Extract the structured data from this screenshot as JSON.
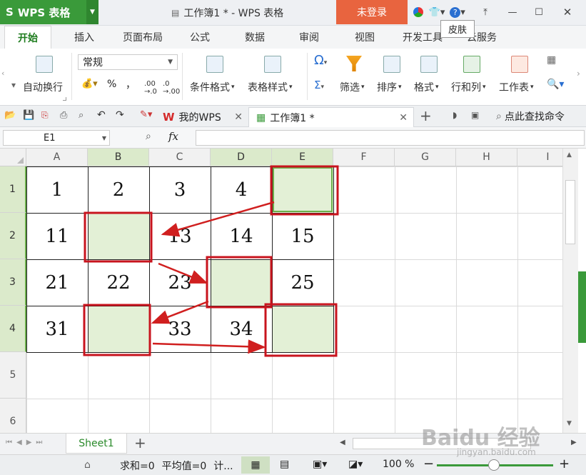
{
  "app": {
    "brand": "WPS 表格",
    "doc_title": "工作簿1 * - WPS 表格",
    "login_label": "未登录",
    "tooltip": "皮肤"
  },
  "ribbon_tabs": [
    "开始",
    "插入",
    "页面布局",
    "公式",
    "数据",
    "审阅",
    "视图",
    "开发工具",
    "云服务"
  ],
  "ribbon": {
    "wrap_label": "自动换行",
    "format_value": "常规",
    "percent": "%",
    "comma": "，",
    "cond_format": "条件格式",
    "table_style": "表格样式",
    "symbol": "Ω",
    "sum": "Σ",
    "filter": "筛选",
    "sort": "排序",
    "format": "格式",
    "row_col": "行和列",
    "worksheet": "工作表"
  },
  "doc_tabs": [
    {
      "label": "我的WPS"
    },
    {
      "label": "工作簿1 *"
    }
  ],
  "search_cmd": "点此查找命令",
  "name_box": "E1",
  "fx": "fx",
  "columns": [
    "A",
    "B",
    "C",
    "D",
    "E",
    "F",
    "G",
    "H",
    "I"
  ],
  "rows": [
    "1",
    "2",
    "3",
    "4",
    "5",
    "6"
  ],
  "cells": [
    [
      "1",
      "2",
      "3",
      "4",
      ""
    ],
    [
      "11",
      "",
      "13",
      "14",
      "15"
    ],
    [
      "21",
      "22",
      "23",
      "",
      "25"
    ],
    [
      "31",
      "",
      "33",
      "34",
      ""
    ]
  ],
  "sheet_tab": "Sheet1",
  "status": {
    "sum": "求和=0",
    "avg": "平均值=0",
    "more": "计...",
    "zoom": "100 %"
  },
  "watermark": {
    "main": "Baidu 经验",
    "sub": "jingyan.baidu.com"
  },
  "colors": {
    "brand_green": "#3a9a3a",
    "login_orange": "#e8643f",
    "highlight_fill": "#e3f0d6",
    "arrow_red": "#d01f1f"
  }
}
